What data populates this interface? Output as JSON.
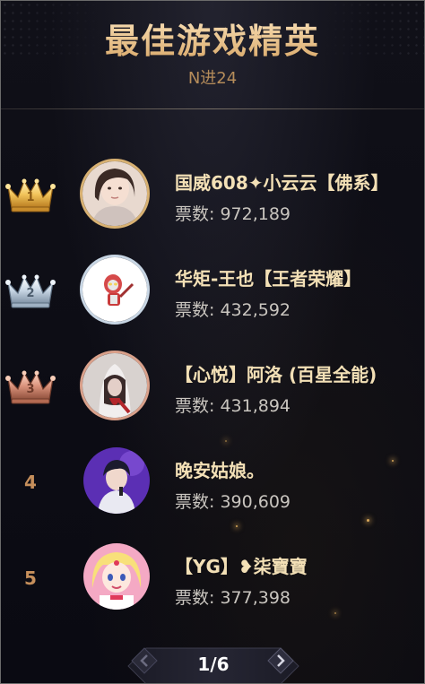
{
  "header": {
    "title": "最佳游戏精英",
    "subtitle": "N进24"
  },
  "leaderboard": [
    {
      "rank": "1",
      "name": "国威608✦小云云【佛系】",
      "votes_label": "票数:",
      "votes": "972,189",
      "badge": "gold-crown"
    },
    {
      "rank": "2",
      "name": "华矩-王也【王者荣耀】",
      "votes_label": "票数:",
      "votes": "432,592",
      "badge": "silver-crown"
    },
    {
      "rank": "3",
      "name": "【心悦】阿洛 (百星全能)",
      "votes_label": "票数:",
      "votes": "431,894",
      "badge": "bronze-crown"
    },
    {
      "rank": "4",
      "name": "晚安姑娘。",
      "votes_label": "票数:",
      "votes": "390,609",
      "badge": ""
    },
    {
      "rank": "5",
      "name": "【YG】❥柒寶寶",
      "votes_label": "票数:",
      "votes": "377,398",
      "badge": ""
    }
  ],
  "pagination": {
    "current": "1",
    "total": "6",
    "prev_icon": "chevron-left-icon",
    "next_icon": "chevron-right-icon"
  },
  "colors": {
    "accent_gold": "#e9c690",
    "rank_number": "#c68f5b",
    "gold": "#f2c45a",
    "silver": "#c8d6e4",
    "bronze": "#d9917a"
  }
}
